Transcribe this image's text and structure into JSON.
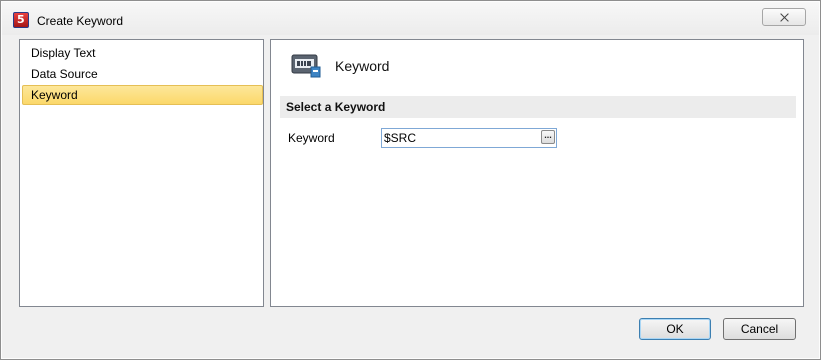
{
  "window": {
    "title": "Create Keyword",
    "app_icon": "flowjo-app-icon",
    "close_icon": "close-icon"
  },
  "nav": {
    "items": [
      {
        "label": "Display Text",
        "selected": false
      },
      {
        "label": "Data Source",
        "selected": false
      },
      {
        "label": "Keyword",
        "selected": true
      }
    ]
  },
  "content": {
    "heading_icon": "keyword-icon",
    "heading": "Keyword",
    "section_title": "Select a Keyword",
    "field_label": "Keyword",
    "field_value": "$SRC",
    "browse_button_label": "...",
    "browse_icon": "ellipsis-icon"
  },
  "footer": {
    "ok_label": "OK",
    "cancel_label": "Cancel"
  },
  "colors": {
    "selection": "#fcdc7b",
    "input_border": "#7fa8d6",
    "section_bg": "#ececec"
  }
}
